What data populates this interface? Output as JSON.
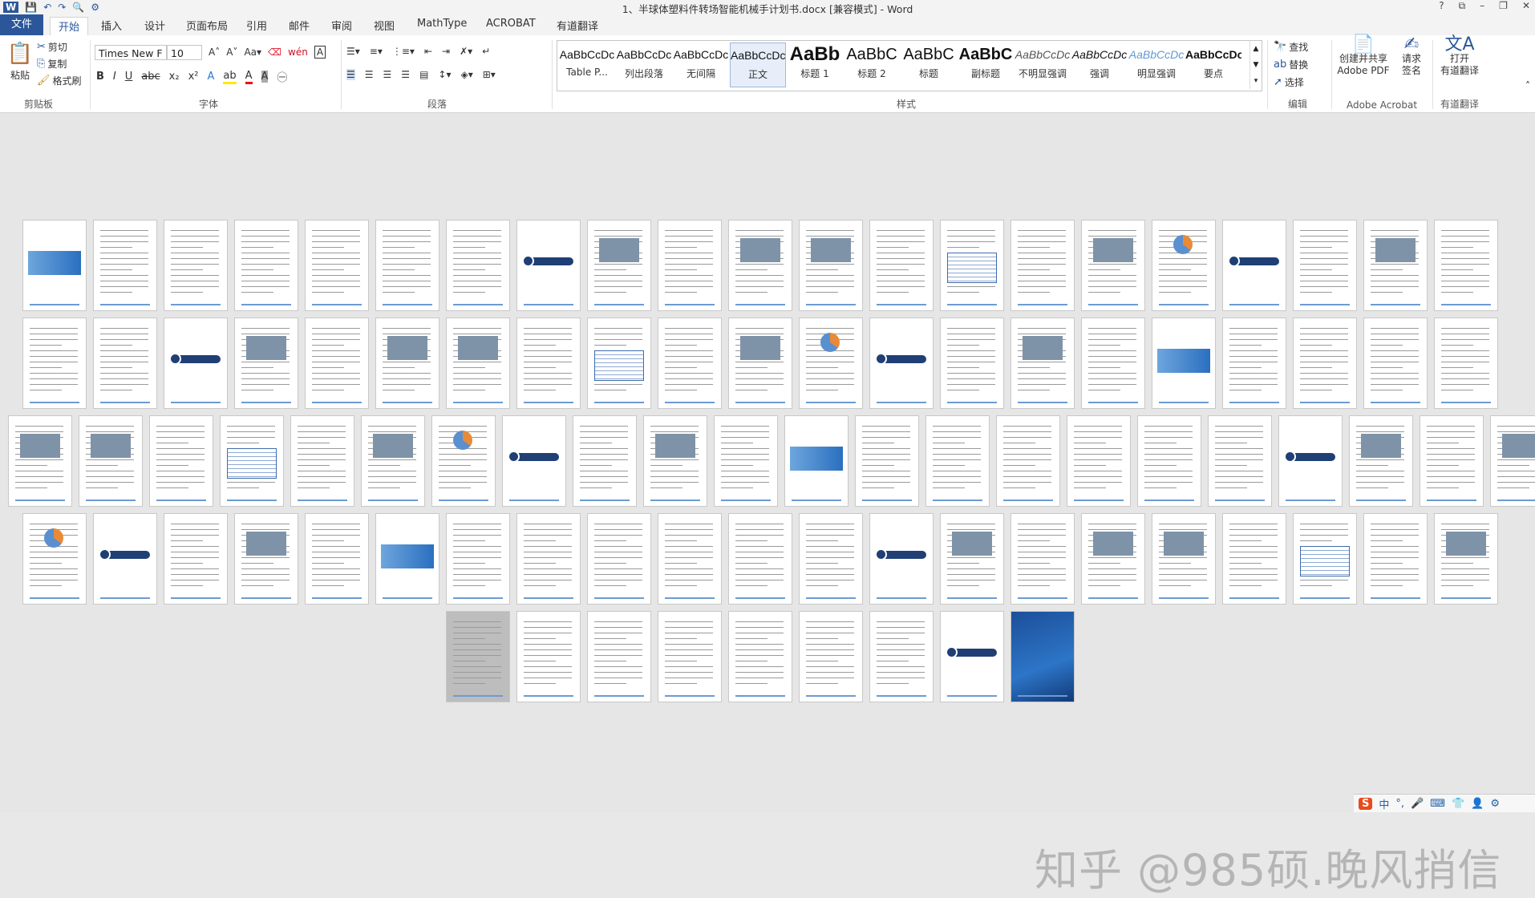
{
  "window": {
    "title": "1、半球体塑料件转场智能机械手计划书.docx [兼容模式] - Word",
    "controls": [
      "?",
      "⧉",
      "–",
      "❐",
      "✕"
    ]
  },
  "qat": [
    "W",
    "💾",
    "↶",
    "↷",
    "🔍",
    "⚙"
  ],
  "tabs": [
    "文件",
    "开始",
    "插入",
    "设计",
    "页面布局",
    "引用",
    "邮件",
    "审阅",
    "视图",
    "MathType",
    "ACROBAT",
    "有道翻译"
  ],
  "clipboard": {
    "paste": "粘贴",
    "cut": "剪切",
    "copy": "复制",
    "format_painter": "格式刷",
    "label": "剪贴板"
  },
  "font": {
    "name": "Times New F",
    "size": "10",
    "label": "字体",
    "wen": "wén",
    "a_label": "A"
  },
  "paragraph": {
    "label": "段落"
  },
  "styles": {
    "label": "样式",
    "items": [
      {
        "preview": "AaBbCcDc",
        "name": "Table P..."
      },
      {
        "preview": "AaBbCcDc",
        "name": "列出段落"
      },
      {
        "preview": "AaBbCcDc",
        "name": "无间隔"
      },
      {
        "preview": "AaBbCcDc",
        "name": "正文"
      },
      {
        "preview": "AaBb",
        "name": "标题 1"
      },
      {
        "preview": "AaBbC",
        "name": "标题 2"
      },
      {
        "preview": "AaBbC",
        "name": "标题"
      },
      {
        "preview": "AaBbC",
        "name": "副标题"
      },
      {
        "preview": "AaBbCcDc",
        "name": "不明显强调"
      },
      {
        "preview": "AaBbCcDc",
        "name": "强调"
      },
      {
        "preview": "AaBbCcDc",
        "name": "明显强调"
      },
      {
        "preview": "AaBbCcDc",
        "name": "要点"
      }
    ]
  },
  "editing": {
    "find": "查找",
    "replace": "替换",
    "select": "选择",
    "label": "编辑"
  },
  "acrobat": {
    "create": "创建并共享\nAdobe PDF",
    "sign": "请求\n签名",
    "label": "Adobe Acrobat"
  },
  "youdao": {
    "open": "打开\n有道翻译",
    "label": "有道翻译"
  },
  "watermark": "知乎 @985硕.晚风捎信",
  "ime": [
    "S",
    "中",
    "°,",
    "🎤",
    "⌨",
    "👕",
    "👤",
    "⚙"
  ]
}
